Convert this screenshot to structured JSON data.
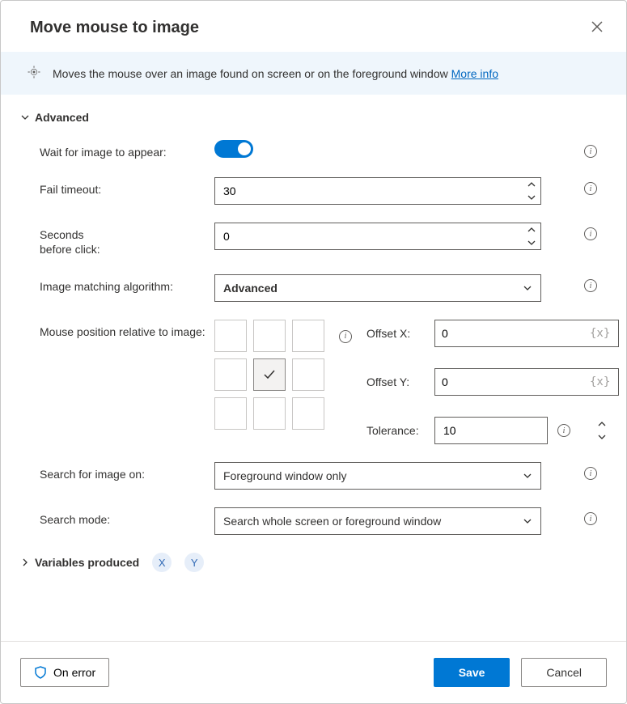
{
  "dialog": {
    "title": "Move mouse to image",
    "description": "Moves the mouse over an image found on screen or on the foreground window",
    "more_info": "More info"
  },
  "section_advanced": "Advanced",
  "fields": {
    "wait_for_image": {
      "label": "Wait for image to appear:",
      "value": true
    },
    "fail_timeout": {
      "label": "Fail timeout:",
      "value": "30"
    },
    "seconds_before_click": {
      "label": "Seconds\nbefore click:",
      "value": "0"
    },
    "image_matching_algo": {
      "label": "Image matching algorithm:",
      "value": "Advanced"
    },
    "mouse_position": {
      "label": "Mouse position relative to image:",
      "selected_index": 4
    },
    "offset_x": {
      "label": "Offset X:",
      "value": "0",
      "placeholder": "{x}"
    },
    "offset_y": {
      "label": "Offset Y:",
      "value": "0",
      "placeholder": "{x}"
    },
    "tolerance": {
      "label": "Tolerance:",
      "value": "10"
    },
    "search_on": {
      "label": "Search for image on:",
      "value": "Foreground window only"
    },
    "search_mode": {
      "label": "Search mode:",
      "value": "Search whole screen or foreground window"
    }
  },
  "variables_produced": {
    "label": "Variables produced",
    "vars": [
      "X",
      "Y"
    ]
  },
  "footer": {
    "on_error": "On error",
    "save": "Save",
    "cancel": "Cancel"
  }
}
